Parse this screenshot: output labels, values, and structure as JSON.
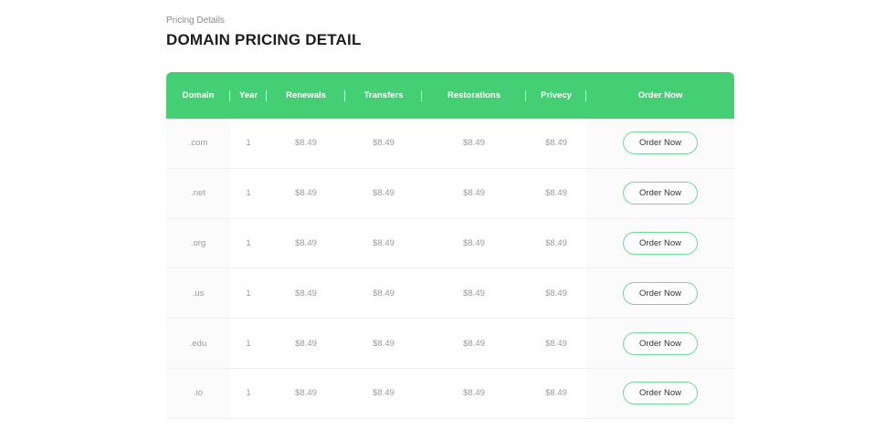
{
  "header": {
    "eyebrow": "Pricing Details",
    "title": "DOMAIN PRICING DETAIL"
  },
  "colors": {
    "header_green": "#45cf75",
    "button_border": "#6fdc95"
  },
  "table": {
    "columns": [
      "Domain",
      "Year",
      "Renewals",
      "Transfers",
      "Restorations",
      "Privecy",
      "Order Now"
    ],
    "rows": [
      {
        "domain": ".com",
        "year": "1",
        "renewals": "$8.49",
        "transfers": "$8.49",
        "restorations": "$8.49",
        "privecy": "$8.49",
        "action": "Order Now"
      },
      {
        "domain": ".net",
        "year": "1",
        "renewals": "$8.49",
        "transfers": "$8.49",
        "restorations": "$8.49",
        "privecy": "$8.49",
        "action": "Order Now"
      },
      {
        "domain": ".org",
        "year": "1",
        "renewals": "$8.49",
        "transfers": "$8.49",
        "restorations": "$8.49",
        "privecy": "$8.49",
        "action": "Order Now"
      },
      {
        "domain": ".us",
        "year": "1",
        "renewals": "$8.49",
        "transfers": "$8.49",
        "restorations": "$8.49",
        "privecy": "$8.49",
        "action": "Order Now"
      },
      {
        "domain": ".edu",
        "year": "1",
        "renewals": "$8.49",
        "transfers": "$8.49",
        "restorations": "$8.49",
        "privecy": "$8.49",
        "action": "Order Now"
      },
      {
        "domain": ".io",
        "year": "1",
        "renewals": "$8.49",
        "transfers": "$8.49",
        "restorations": "$8.49",
        "privecy": "$8.49",
        "action": "Order Now"
      }
    ]
  }
}
